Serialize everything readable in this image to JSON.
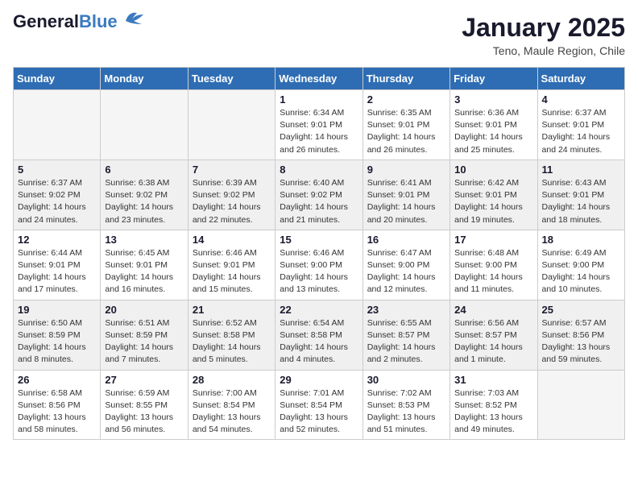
{
  "logo": {
    "line1": "General",
    "line2": "Blue"
  },
  "header": {
    "month": "January 2025",
    "location": "Teno, Maule Region, Chile"
  },
  "weekdays": [
    "Sunday",
    "Monday",
    "Tuesday",
    "Wednesday",
    "Thursday",
    "Friday",
    "Saturday"
  ],
  "weeks": [
    [
      {
        "day": "",
        "info": ""
      },
      {
        "day": "",
        "info": ""
      },
      {
        "day": "",
        "info": ""
      },
      {
        "day": "1",
        "info": "Sunrise: 6:34 AM\nSunset: 9:01 PM\nDaylight: 14 hours and 26 minutes."
      },
      {
        "day": "2",
        "info": "Sunrise: 6:35 AM\nSunset: 9:01 PM\nDaylight: 14 hours and 26 minutes."
      },
      {
        "day": "3",
        "info": "Sunrise: 6:36 AM\nSunset: 9:01 PM\nDaylight: 14 hours and 25 minutes."
      },
      {
        "day": "4",
        "info": "Sunrise: 6:37 AM\nSunset: 9:01 PM\nDaylight: 14 hours and 24 minutes."
      }
    ],
    [
      {
        "day": "5",
        "info": "Sunrise: 6:37 AM\nSunset: 9:02 PM\nDaylight: 14 hours and 24 minutes."
      },
      {
        "day": "6",
        "info": "Sunrise: 6:38 AM\nSunset: 9:02 PM\nDaylight: 14 hours and 23 minutes."
      },
      {
        "day": "7",
        "info": "Sunrise: 6:39 AM\nSunset: 9:02 PM\nDaylight: 14 hours and 22 minutes."
      },
      {
        "day": "8",
        "info": "Sunrise: 6:40 AM\nSunset: 9:02 PM\nDaylight: 14 hours and 21 minutes."
      },
      {
        "day": "9",
        "info": "Sunrise: 6:41 AM\nSunset: 9:01 PM\nDaylight: 14 hours and 20 minutes."
      },
      {
        "day": "10",
        "info": "Sunrise: 6:42 AM\nSunset: 9:01 PM\nDaylight: 14 hours and 19 minutes."
      },
      {
        "day": "11",
        "info": "Sunrise: 6:43 AM\nSunset: 9:01 PM\nDaylight: 14 hours and 18 minutes."
      }
    ],
    [
      {
        "day": "12",
        "info": "Sunrise: 6:44 AM\nSunset: 9:01 PM\nDaylight: 14 hours and 17 minutes."
      },
      {
        "day": "13",
        "info": "Sunrise: 6:45 AM\nSunset: 9:01 PM\nDaylight: 14 hours and 16 minutes."
      },
      {
        "day": "14",
        "info": "Sunrise: 6:46 AM\nSunset: 9:01 PM\nDaylight: 14 hours and 15 minutes."
      },
      {
        "day": "15",
        "info": "Sunrise: 6:46 AM\nSunset: 9:00 PM\nDaylight: 14 hours and 13 minutes."
      },
      {
        "day": "16",
        "info": "Sunrise: 6:47 AM\nSunset: 9:00 PM\nDaylight: 14 hours and 12 minutes."
      },
      {
        "day": "17",
        "info": "Sunrise: 6:48 AM\nSunset: 9:00 PM\nDaylight: 14 hours and 11 minutes."
      },
      {
        "day": "18",
        "info": "Sunrise: 6:49 AM\nSunset: 9:00 PM\nDaylight: 14 hours and 10 minutes."
      }
    ],
    [
      {
        "day": "19",
        "info": "Sunrise: 6:50 AM\nSunset: 8:59 PM\nDaylight: 14 hours and 8 minutes."
      },
      {
        "day": "20",
        "info": "Sunrise: 6:51 AM\nSunset: 8:59 PM\nDaylight: 14 hours and 7 minutes."
      },
      {
        "day": "21",
        "info": "Sunrise: 6:52 AM\nSunset: 8:58 PM\nDaylight: 14 hours and 5 minutes."
      },
      {
        "day": "22",
        "info": "Sunrise: 6:54 AM\nSunset: 8:58 PM\nDaylight: 14 hours and 4 minutes."
      },
      {
        "day": "23",
        "info": "Sunrise: 6:55 AM\nSunset: 8:57 PM\nDaylight: 14 hours and 2 minutes."
      },
      {
        "day": "24",
        "info": "Sunrise: 6:56 AM\nSunset: 8:57 PM\nDaylight: 14 hours and 1 minute."
      },
      {
        "day": "25",
        "info": "Sunrise: 6:57 AM\nSunset: 8:56 PM\nDaylight: 13 hours and 59 minutes."
      }
    ],
    [
      {
        "day": "26",
        "info": "Sunrise: 6:58 AM\nSunset: 8:56 PM\nDaylight: 13 hours and 58 minutes."
      },
      {
        "day": "27",
        "info": "Sunrise: 6:59 AM\nSunset: 8:55 PM\nDaylight: 13 hours and 56 minutes."
      },
      {
        "day": "28",
        "info": "Sunrise: 7:00 AM\nSunset: 8:54 PM\nDaylight: 13 hours and 54 minutes."
      },
      {
        "day": "29",
        "info": "Sunrise: 7:01 AM\nSunset: 8:54 PM\nDaylight: 13 hours and 52 minutes."
      },
      {
        "day": "30",
        "info": "Sunrise: 7:02 AM\nSunset: 8:53 PM\nDaylight: 13 hours and 51 minutes."
      },
      {
        "day": "31",
        "info": "Sunrise: 7:03 AM\nSunset: 8:52 PM\nDaylight: 13 hours and 49 minutes."
      },
      {
        "day": "",
        "info": ""
      }
    ]
  ]
}
